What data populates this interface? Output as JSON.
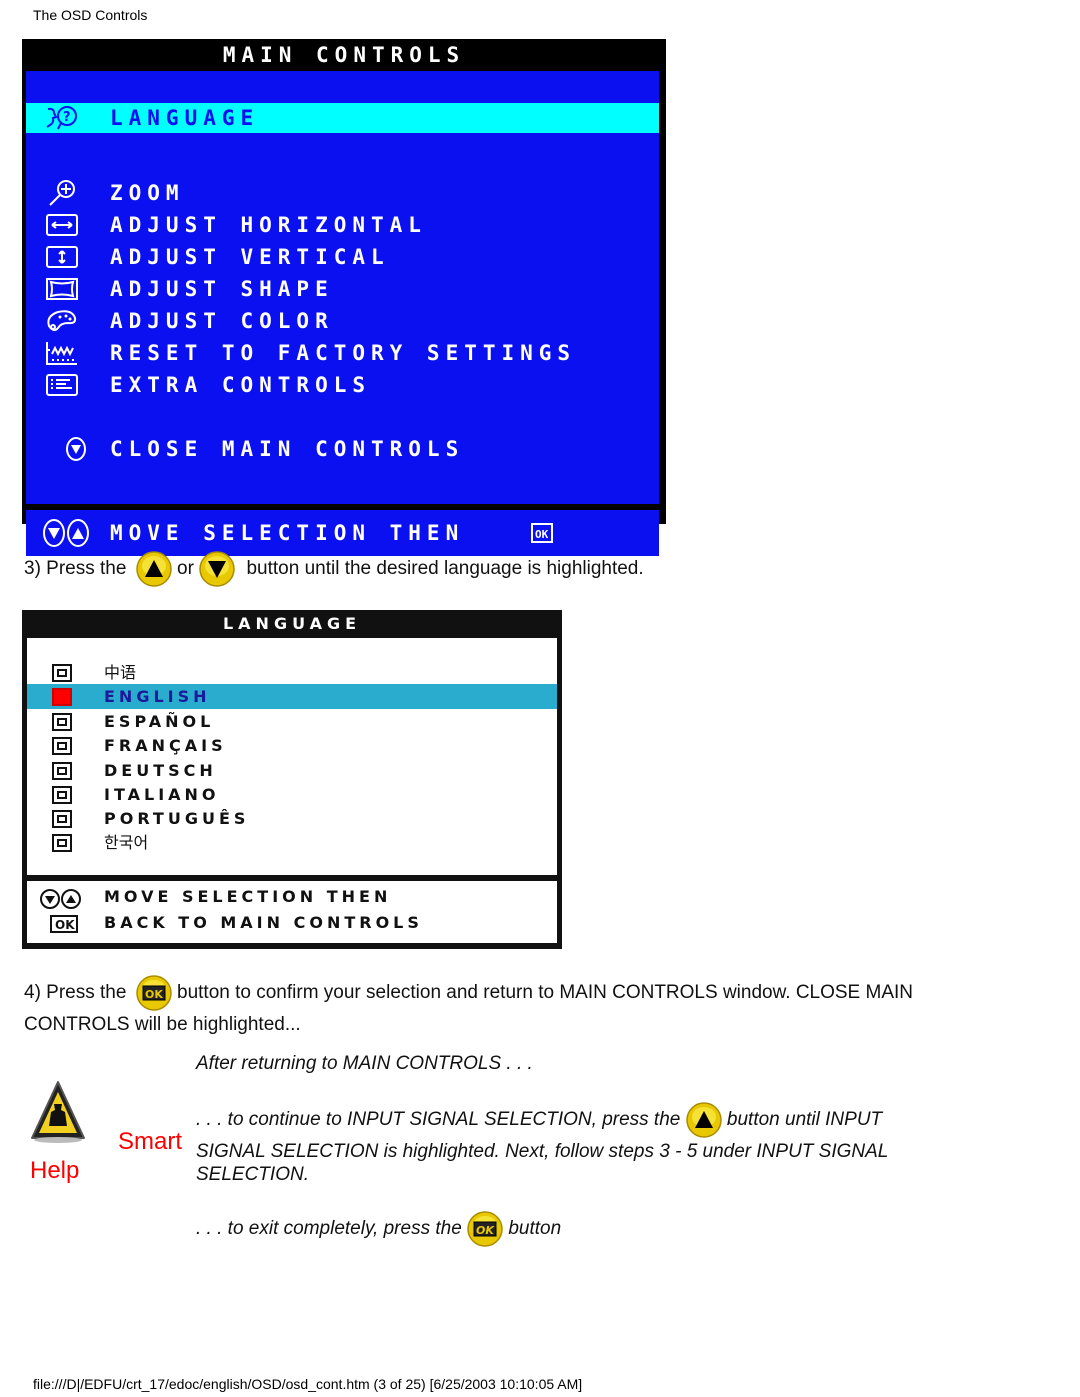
{
  "page": {
    "header_title": "The OSD Controls",
    "footer_path": "file:///D|/EDFU/crt_17/edoc/english/OSD/osd_cont.htm (3 of 25) [6/25/2003 10:10:05 AM]"
  },
  "main_controls": {
    "title": "MAIN CONTROLS",
    "colors": {
      "background": "#0a10f0",
      "highlight": "#00ffff",
      "text": "#ffffff"
    },
    "items": [
      {
        "icon": "language-icon",
        "label": "LANGUAGE",
        "selected": true
      },
      {
        "icon": "zoom-icon",
        "label": "ZOOM",
        "selected": false
      },
      {
        "icon": "adjust-horizontal-icon",
        "label": "ADJUST HORIZONTAL",
        "selected": false
      },
      {
        "icon": "adjust-vertical-icon",
        "label": "ADJUST VERTICAL",
        "selected": false
      },
      {
        "icon": "adjust-shape-icon",
        "label": "ADJUST SHAPE",
        "selected": false
      },
      {
        "icon": "adjust-color-icon",
        "label": "ADJUST COLOR",
        "selected": false
      },
      {
        "icon": "reset-factory-icon",
        "label": "RESET TO FACTORY SETTINGS",
        "selected": false
      },
      {
        "icon": "extra-controls-icon",
        "label": "EXTRA CONTROLS",
        "selected": false
      },
      {
        "icon": "down-arrow-icon",
        "label": "CLOSE MAIN CONTROLS",
        "selected": false
      }
    ],
    "footer": "MOVE SELECTION THEN"
  },
  "step3": {
    "prefix": "3) Press the",
    "or": "or",
    "suffix": "button until the desired language is highlighted."
  },
  "language_menu": {
    "title": "LANGUAGE",
    "colors": {
      "highlight": "#2aaccf",
      "selected_box": "#ff0000"
    },
    "items": [
      {
        "label": "中语",
        "selected": false,
        "native": true
      },
      {
        "label": "ENGLISH",
        "selected": true,
        "native": false
      },
      {
        "label": "ESPAÑOL",
        "selected": false,
        "native": false
      },
      {
        "label": "FRANÇAIS",
        "selected": false,
        "native": false
      },
      {
        "label": "DEUTSCH",
        "selected": false,
        "native": false
      },
      {
        "label": "ITALIANO",
        "selected": false,
        "native": false
      },
      {
        "label": "PORTUGUÊS",
        "selected": false,
        "native": false
      },
      {
        "label": "한국어",
        "selected": false,
        "native": true
      }
    ],
    "footer_line1": "MOVE SELECTION THEN",
    "footer_line2": "BACK TO MAIN CONTROLS"
  },
  "step4": {
    "prefix": "4) Press the",
    "suffix": "button to confirm your selection and return to MAIN CONTROLS window. CLOSE MAIN",
    "line2": "CONTROLS will be highlighted..."
  },
  "smart_help": {
    "label_smart": "Smart",
    "label_help": "Help",
    "after_returning": "After returning to MAIN CONTROLS . . .",
    "continue_prefix": ". . . to continue to INPUT SIGNAL SELECTION, press the",
    "continue_suffix": "button until INPUT",
    "continue_line2": "SIGNAL SELECTION is highlighted. Next, follow steps 3 - 5 under INPUT SIGNAL",
    "continue_line3": "SELECTION.",
    "exit_prefix": ". . . to exit completely, press the",
    "exit_suffix": "button"
  }
}
